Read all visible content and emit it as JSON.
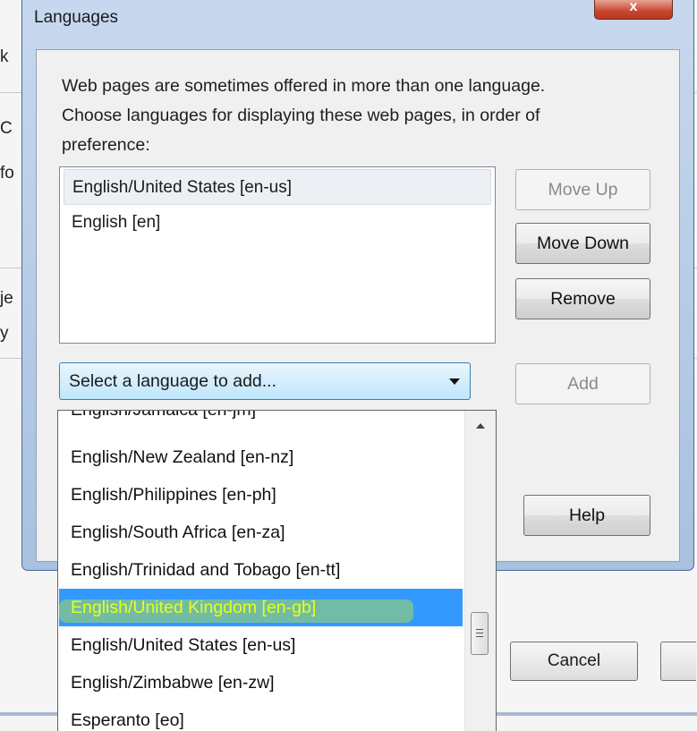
{
  "background": {
    "fragments": [
      "k",
      "C",
      "fo",
      "je",
      "y"
    ],
    "cancel_label": "Cancel"
  },
  "dialog": {
    "title": "Languages",
    "close_glyph": "x",
    "description_lines": [
      "Web pages are sometimes offered in more than one language.",
      "Choose languages for displaying these web pages, in order of",
      "preference:"
    ],
    "languages": [
      {
        "label": "English/United States  [en-us]",
        "selected": true
      },
      {
        "label": "English  [en]",
        "selected": false
      }
    ],
    "buttons": {
      "move_up": "Move Up",
      "move_down": "Move Down",
      "remove": "Remove",
      "add": "Add",
      "help": "Help"
    },
    "select_placeholder": "Select a language to add...",
    "dropdown_options": [
      "English/Jamaica  [en-jm]",
      "English/New Zealand  [en-nz]",
      "English/Philippines  [en-ph]",
      "English/South Africa  [en-za]",
      "English/Trinidad and Tobago  [en-tt]",
      "English/United Kingdom  [en-gb]",
      "English/United States  [en-us]",
      "English/Zimbabwe  [en-zw]",
      "Esperanto  [eo]"
    ],
    "highlighted_option": "English/United Kingdom  [en-gb]"
  },
  "colors": {
    "highlight_bg": "#3399ff",
    "highlight_text": "#e6ff1a",
    "dialog_frame": "#a8c1e0"
  }
}
